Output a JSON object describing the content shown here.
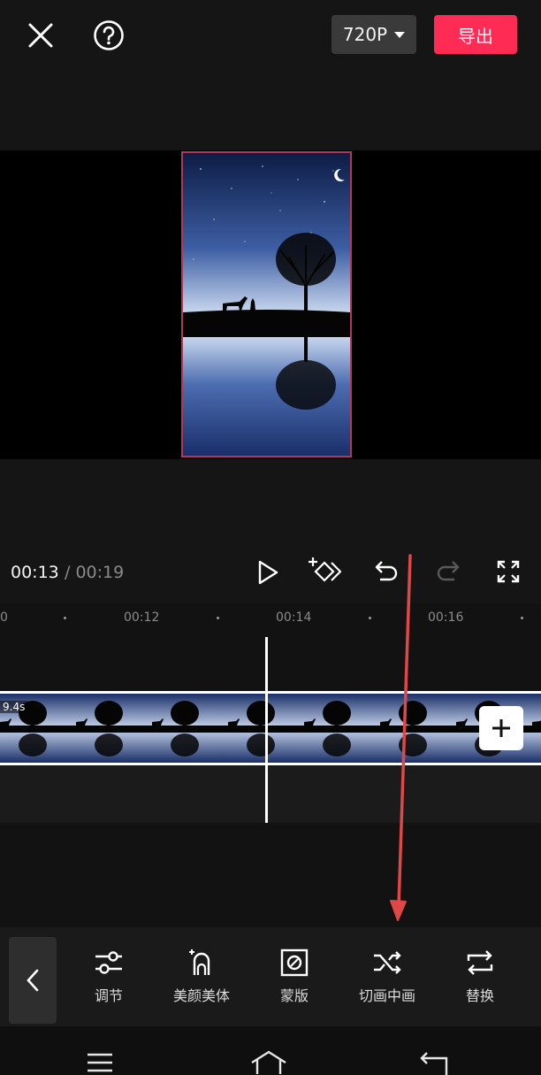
{
  "topbar": {
    "resolution_label": "720P",
    "export_label": "导出"
  },
  "player": {
    "current_time": "00:13",
    "total_time": "/ 00:19"
  },
  "ruler": {
    "labels": [
      "0",
      "00:12",
      "00:14",
      "00:16"
    ]
  },
  "timeline": {
    "clip_duration": "9.4s"
  },
  "toolbar": {
    "items": [
      {
        "label": "调节",
        "icon": "sliders-icon"
      },
      {
        "label": "美颜美体",
        "icon": "face-beauty-icon"
      },
      {
        "label": "蒙版",
        "icon": "mask-icon"
      },
      {
        "label": "切画中画",
        "icon": "shuffle-icon"
      },
      {
        "label": "替换",
        "icon": "replace-icon"
      }
    ]
  },
  "colors": {
    "accent": "#fe2c55",
    "frame_border": "#b0385f",
    "annotation_arrow": "#e04848",
    "background": "#101010"
  }
}
